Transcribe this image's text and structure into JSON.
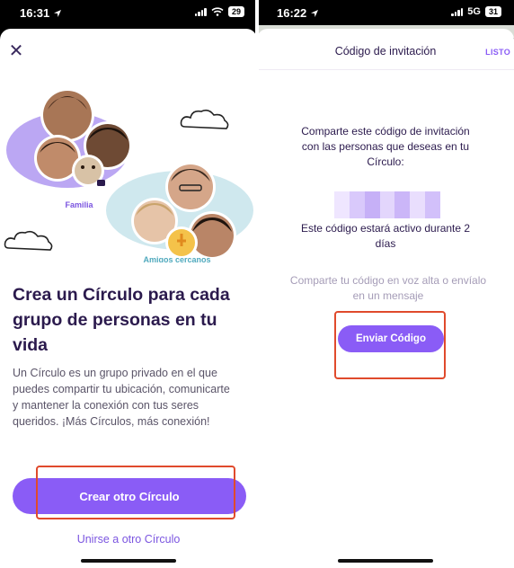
{
  "left": {
    "status": {
      "time": "16:31",
      "battery": "29"
    },
    "close_symbol": "✕",
    "illustration": {
      "group1_label": "Familia",
      "group2_label": "Amigos cercanos"
    },
    "headline": "Crea un Círculo para cada grupo de personas en tu vida",
    "body": "Un Círculo es un grupo privado en el que puedes compartir tu ubicación, comunicarte y mantener la conexión con tus seres queridos. ¡Más Círculos, más conexión!",
    "primary_button": "Crear otro Círculo",
    "secondary_link": "Unirse a otro Círculo"
  },
  "right": {
    "status": {
      "time": "16:22",
      "network": "5G",
      "battery": "31"
    },
    "title": "Código de invitación",
    "done": "LISTO",
    "instructions": "Comparte este código de invitación con las personas que deseas en tu Círculo:",
    "active_note": "Este código estará activo durante 2 días",
    "share_hint": "Comparte tu código en voz alta o envíalo en un mensaje",
    "send_button": "Enviar Código"
  },
  "colors": {
    "accent": "#8a5cf6",
    "headline": "#2b1a4d",
    "highlight": "#e04a2c",
    "bubble_purple": "#bba7f3",
    "bubble_teal": "#cfe8ee"
  },
  "icons": {
    "location_arrow": "location-arrow-icon",
    "close": "close-icon",
    "cloud": "cloud-icon"
  }
}
